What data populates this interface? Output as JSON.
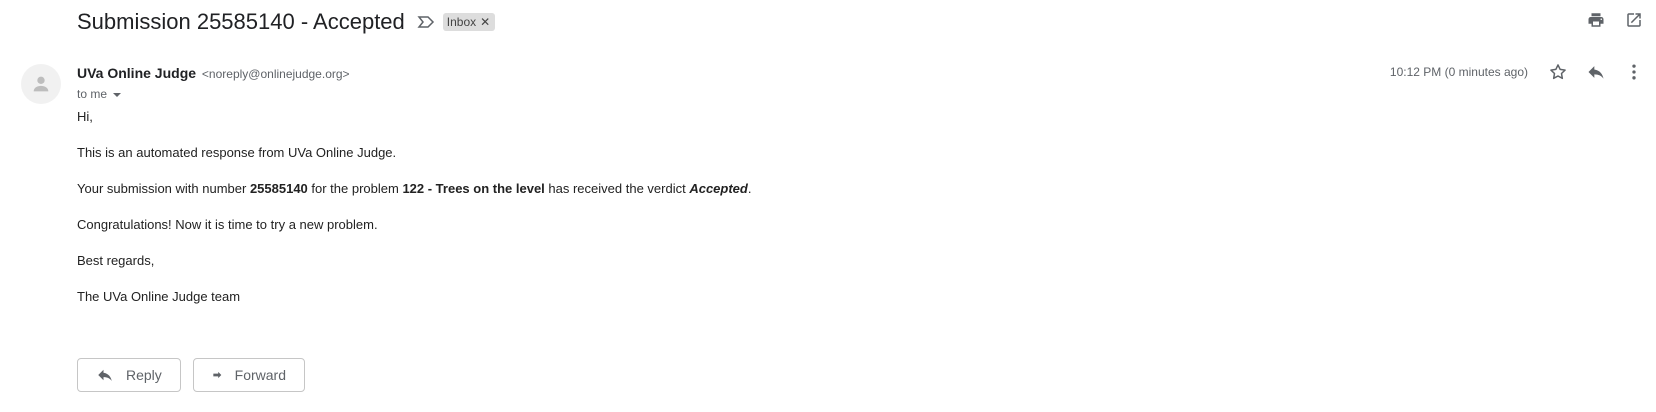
{
  "email": {
    "subject": "Submission 25585140 - Accepted",
    "label": "Inbox",
    "sender_name": "UVa Online Judge",
    "sender_email": "<noreply@onlinejudge.org>",
    "recipient": "to me",
    "timestamp": "10:12 PM (0 minutes ago)"
  },
  "body": {
    "greeting": "Hi,",
    "line1": "This is an automated response from UVa Online Judge.",
    "line2_a": "Your submission with number ",
    "submission_number": "25585140",
    "line2_b": " for the problem ",
    "problem": "122 - Trees on the level",
    "line2_c": " has received the verdict ",
    "verdict": "Accepted",
    "line2_d": ".",
    "line3": "Congratulations! Now it is time to try a new problem.",
    "closing": "Best regards,",
    "signature": "The UVa Online Judge team"
  },
  "actions": {
    "reply_label": "Reply",
    "forward_label": "Forward"
  },
  "icons": {
    "print": "print-icon",
    "open_new_window": "open-in-new-icon",
    "star": "star-icon",
    "reply": "reply-icon",
    "more": "more-vert-icon",
    "important": "important-marker-icon",
    "avatar": "person-icon"
  }
}
